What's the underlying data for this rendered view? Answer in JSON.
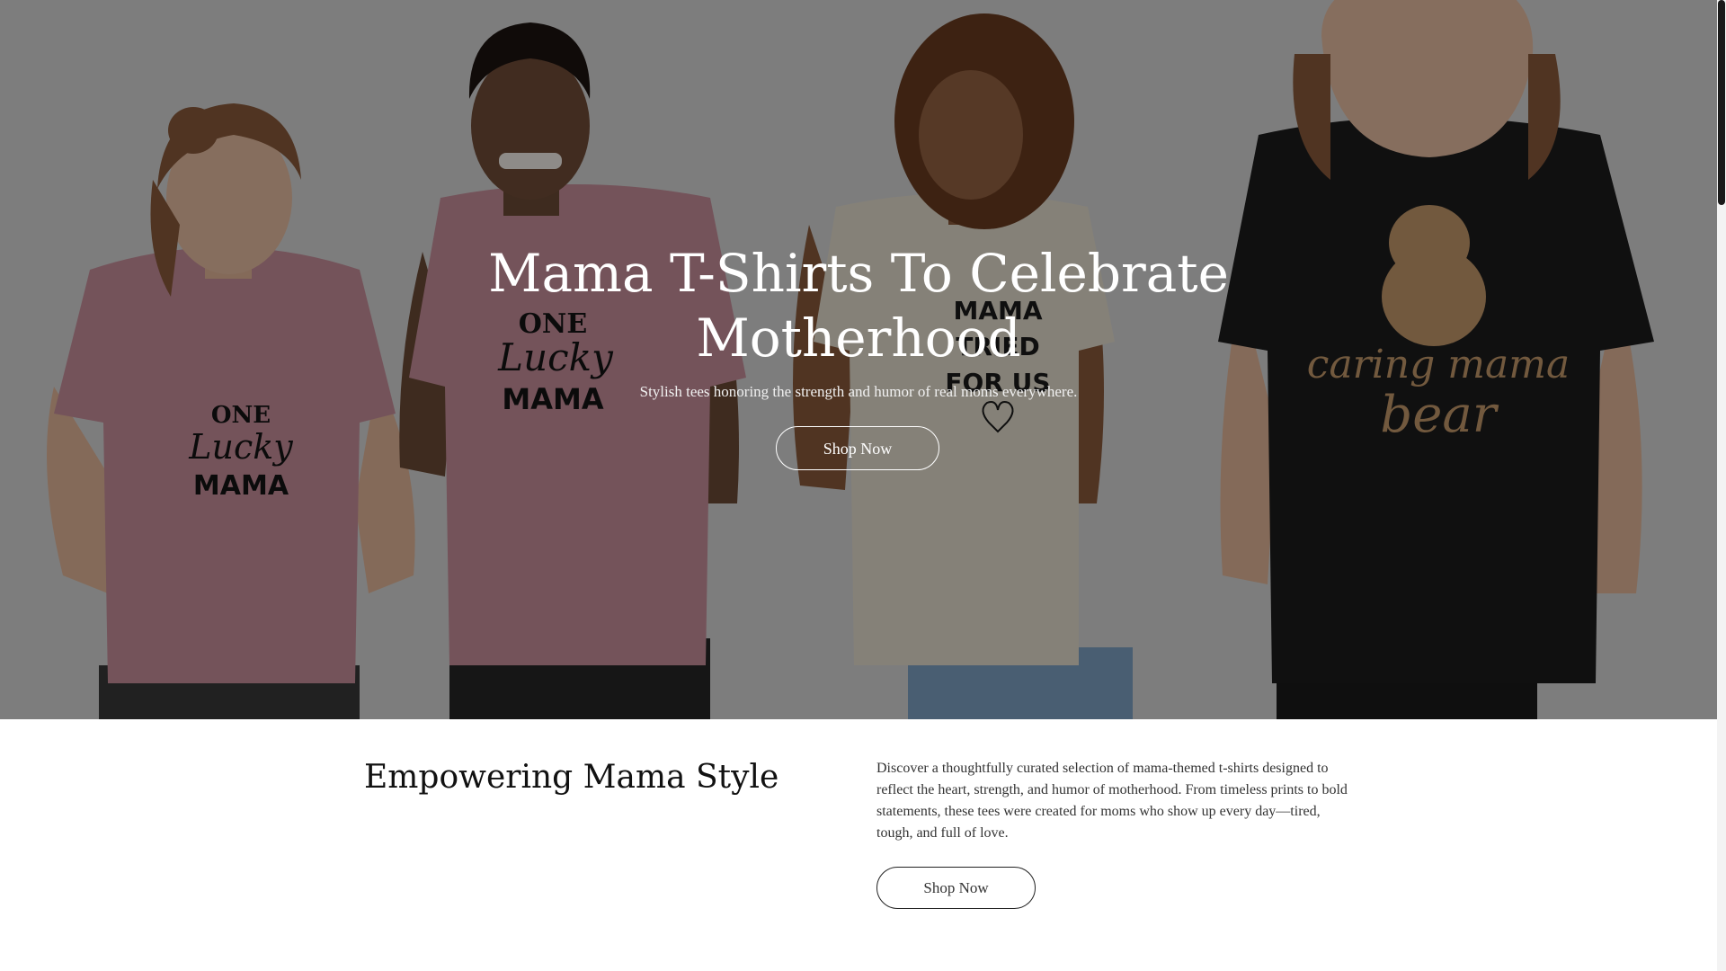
{
  "hero": {
    "title": "Mama T-Shirts To Celebrate Motherhood",
    "subtitle": "Stylish tees honoring the strength and humor of real moms everywhere.",
    "button_label": "Shop Now",
    "shirt_prints": [
      "One Lucky Mama",
      "One Lucky Mama",
      "Mama Tried For Us",
      "caring mama bear"
    ],
    "colors": {
      "overlay": "#000000",
      "shirt_pink": "#c98f9c",
      "shirt_cream": "#e6dfcf",
      "shirt_black": "#1c1c1c",
      "print_tan": "#c49a6c"
    }
  },
  "intro": {
    "heading": "Empowering Mama Style",
    "text": "Discover a thoughtfully curated selection of mama-themed t-shirts designed to reflect the heart, strength, and humor of motherhood. From timeless prints to bold statements, these tees were created for moms who show up every day—tired, tough, and full of love.",
    "button_label": "Shop Now"
  }
}
